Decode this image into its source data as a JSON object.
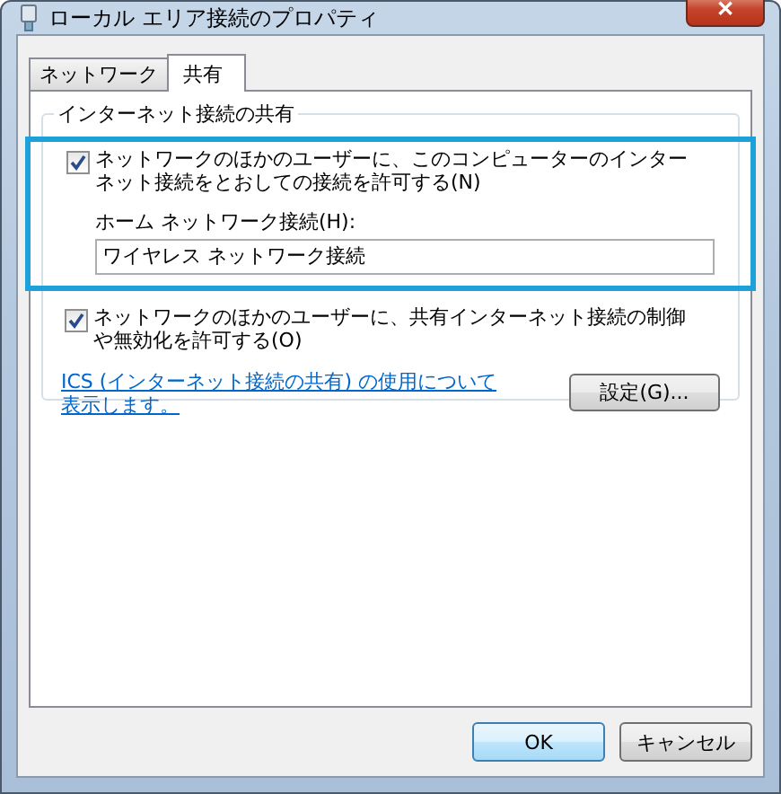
{
  "window": {
    "title": "ローカル エリア接続のプロパティ",
    "close": "✕"
  },
  "tabs": [
    {
      "label": "ネットワーク",
      "selected": false
    },
    {
      "label": "共有",
      "selected": true
    }
  ],
  "group": {
    "title": "インターネット接続の共有",
    "options": [
      {
        "label": "ネットワークのほかのユーザーに、このコンピューターのインターネット接続をとおしての接続を許可する(N)",
        "checked": true,
        "highlighted": true,
        "field_label": "ホーム ネットワーク接続(H):",
        "field_value": "ワイヤレス ネットワーク接続"
      },
      {
        "label": "ネットワークのほかのユーザーに、共有インターネット接続の制御や無効化を許可する(O)",
        "checked": true,
        "highlighted": false
      }
    ],
    "link": "ICS (インターネット接続の共有) の使用について表示します。",
    "settings_button": "設定(G)..."
  },
  "buttons": [
    {
      "label": "OK",
      "default": true
    },
    {
      "label": "キャンセル",
      "default": false
    }
  ]
}
